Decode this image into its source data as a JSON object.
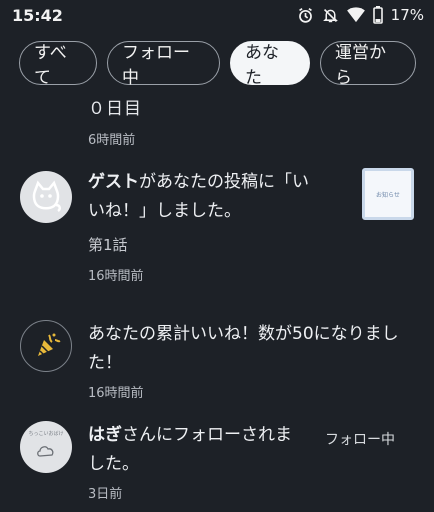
{
  "status_bar": {
    "time": "15:42",
    "battery": "17%",
    "icons": [
      "alarm-icon",
      "mute-icon",
      "wifi-icon",
      "battery-icon"
    ]
  },
  "tabs": [
    {
      "label": "すべて",
      "active": false
    },
    {
      "label": "フォロー中",
      "active": false
    },
    {
      "label": "あなた",
      "active": true
    },
    {
      "label": "運営から",
      "active": false
    }
  ],
  "feed": {
    "partial": {
      "title": "０日目",
      "time": "6時間前"
    },
    "items": [
      {
        "actor": "ゲスト",
        "message": "があなたの投稿に「いいね！」しました。",
        "message_line1": "があなたの投稿に「い",
        "message_line2": "いね！」しました。",
        "subtitle": "第1話",
        "time": "16時間前",
        "avatar": "cat-avatar-icon",
        "thumbnail_text": "お知らせ"
      },
      {
        "message": "あなたの累計いいね！数が50になりました！",
        "message_line1": "あなたの累計いいね！数が50になりまし",
        "message_line2": "た！",
        "time": "16時間前",
        "avatar": "party-popper-icon"
      },
      {
        "actor": "はぎ",
        "message": "さんにフォローされました。",
        "message_line1": "さんにフォローされま",
        "message_line2": "した。",
        "time": "3日前",
        "follow_status": "フォロー中",
        "avatar": "user-avatar-icon",
        "avatar_text": "ちっこいおばけ"
      }
    ]
  },
  "colors": {
    "background": "#1d2127",
    "active_tab": "#f4f6f8",
    "text": "#eef0f3",
    "muted_text": "#b8bcc3"
  }
}
